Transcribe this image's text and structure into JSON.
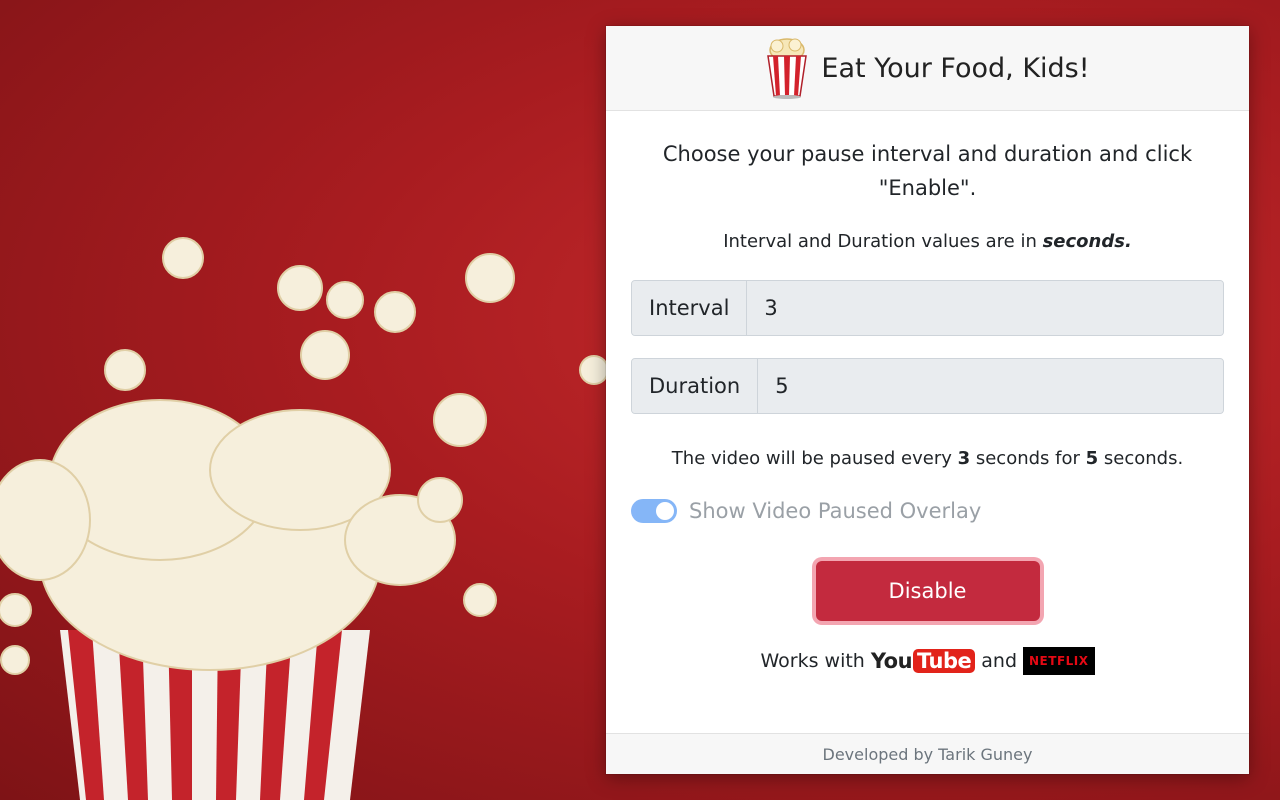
{
  "header": {
    "title": "Eat Your Food, Kids!",
    "logo_icon": "popcorn-icon"
  },
  "intro": "Choose your pause interval and duration and click \"Enable\".",
  "units": {
    "prefix": "Interval and Duration values are in ",
    "emphasis": "seconds."
  },
  "interval": {
    "label": "Interval",
    "value": "3"
  },
  "duration": {
    "label": "Duration",
    "value": "5"
  },
  "summary": {
    "part1": "The video will be paused every ",
    "interval": "3",
    "part2": " seconds for ",
    "duration": "5",
    "part3": " seconds."
  },
  "overlay_toggle": {
    "label": "Show Video Paused Overlay",
    "enabled": true
  },
  "disable_button": "Disable",
  "works_with": {
    "prefix": "Works with",
    "youtube_you": "You",
    "youtube_tube": "Tube",
    "and": "and",
    "netflix": "NETFLIX"
  },
  "footer": "Developed by Tarik Guney",
  "colors": {
    "accent": "#c32a3e",
    "toggle": "#5d9ef5",
    "background": "#b5201f"
  }
}
